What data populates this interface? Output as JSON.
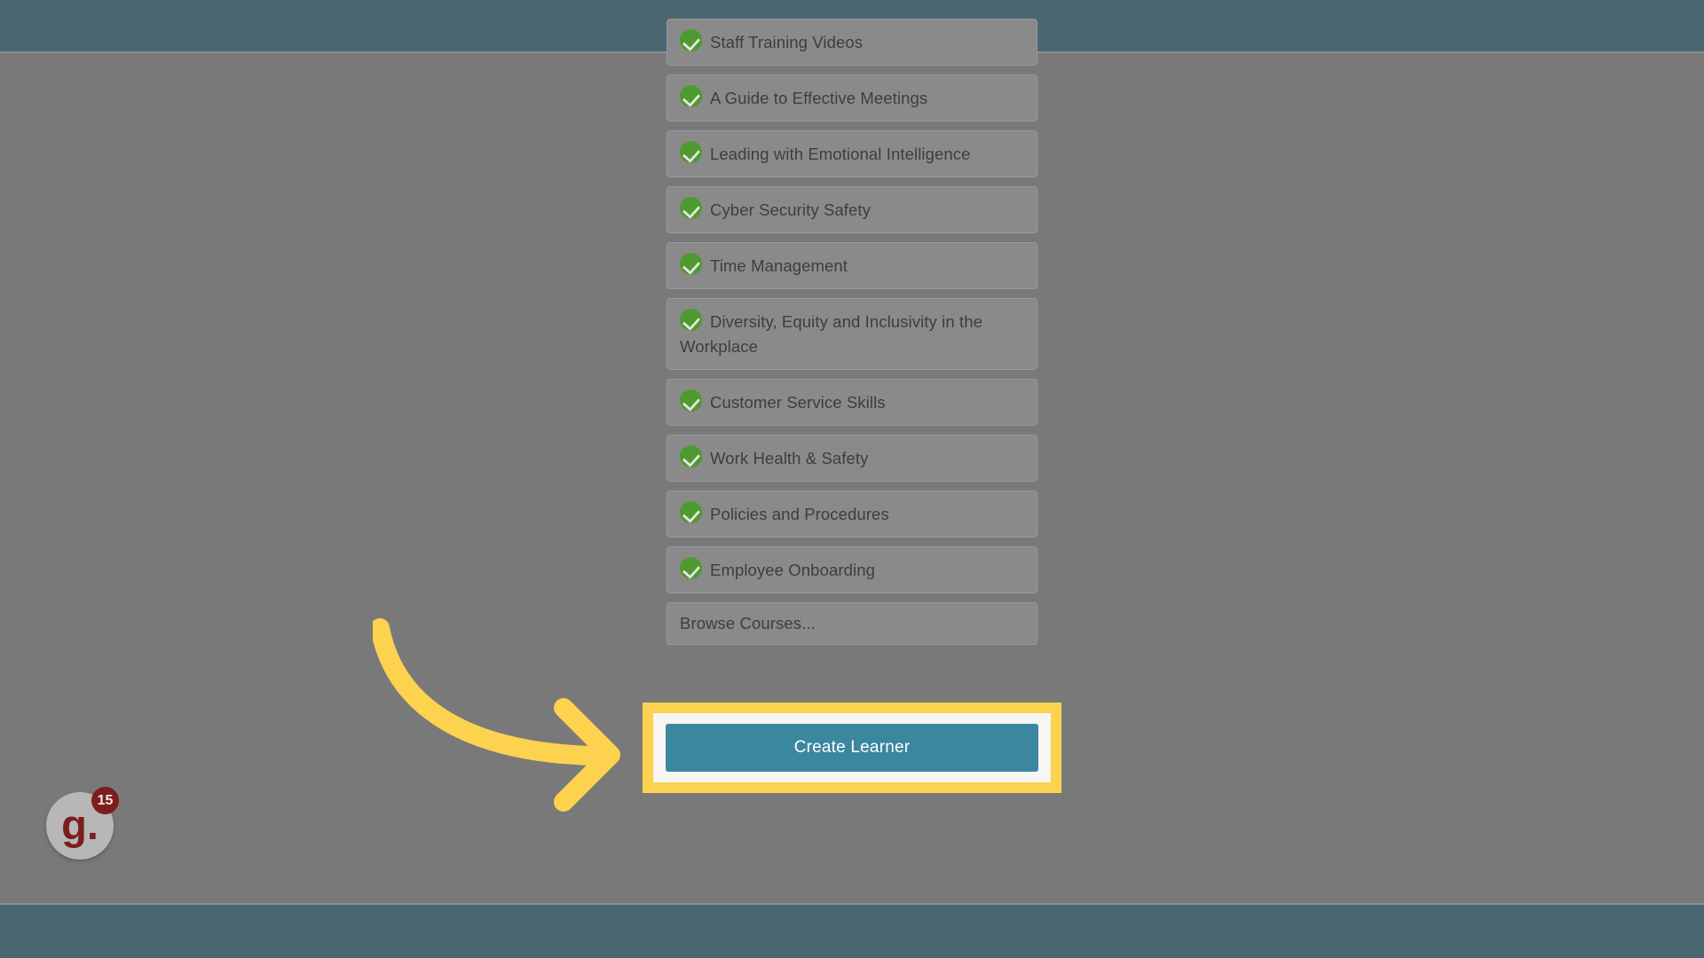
{
  "window": {
    "chrome_color": "#4a6671",
    "overlay_color": "#797979"
  },
  "course_list": {
    "items": [
      {
        "label": "Staff Training Videos",
        "completed": true,
        "clipped": true
      },
      {
        "label": "A Guide to Effective Meetings",
        "completed": true
      },
      {
        "label": "Leading with Emotional Intelligence",
        "completed": true
      },
      {
        "label": "Cyber Security Safety",
        "completed": true
      },
      {
        "label": "Time Management",
        "completed": true
      },
      {
        "label": "Diversity, Equity and Inclusivity in the Workplace",
        "completed": true
      },
      {
        "label": "Customer Service Skills",
        "completed": true
      },
      {
        "label": "Work Health & Safety",
        "completed": true
      },
      {
        "label": "Policies and Procedures",
        "completed": true
      },
      {
        "label": "Employee Onboarding",
        "completed": true
      },
      {
        "label": "Browse Courses...",
        "completed": false
      }
    ],
    "check_icon": "check-circle-icon",
    "check_color": "#4e9a2f"
  },
  "create_learner": {
    "button_label": "Create Learner",
    "button_color": "#3c87a0",
    "highlight_color": "#fdd24e",
    "inner_color": "#f7f6f2"
  },
  "annotation": {
    "arrow_icon": "curved-arrow-right-icon",
    "arrow_color": "#fdd24e"
  },
  "logo_badge": {
    "mark": "g.",
    "count": "15",
    "brand_color": "#7e1d1d",
    "disc_color": "#b7b7b7"
  }
}
